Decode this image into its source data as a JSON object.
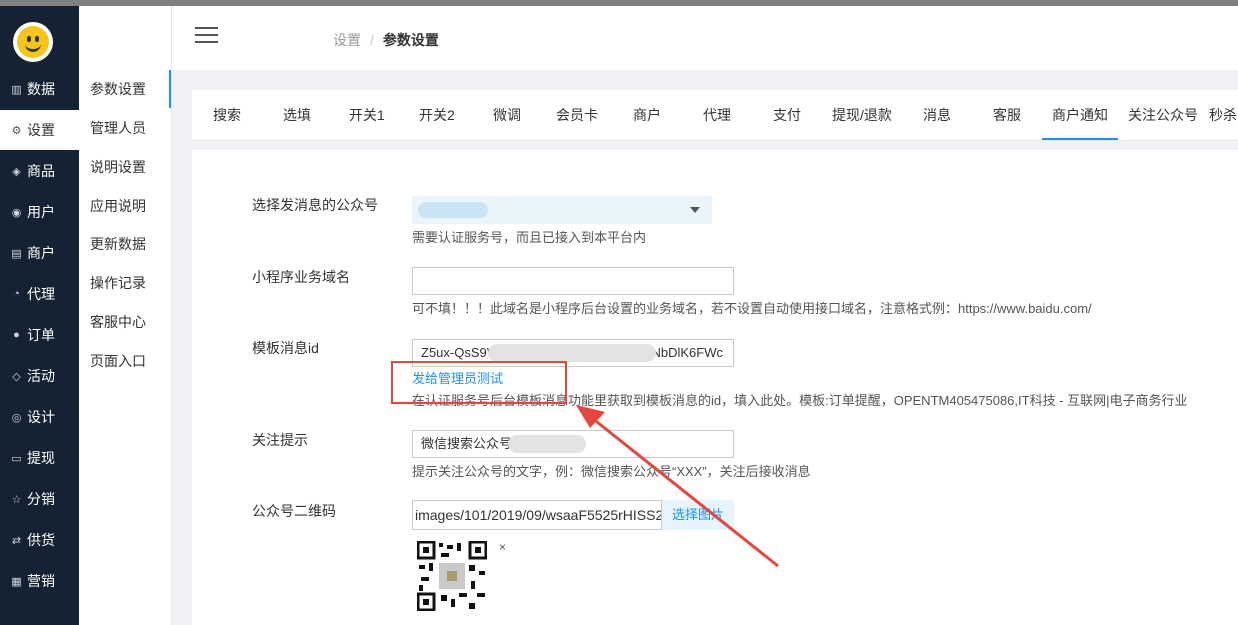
{
  "left_nav": {
    "logo_icon": "smiley-face-icon",
    "items": [
      {
        "label": "数据",
        "icon": "chart-icon"
      },
      {
        "label": "设置",
        "icon": "gear-icon"
      },
      {
        "label": "商品",
        "icon": "box-icon"
      },
      {
        "label": "用户",
        "icon": "user-icon"
      },
      {
        "label": "商户",
        "icon": "store-icon"
      },
      {
        "label": "代理",
        "icon": "agent-icon"
      },
      {
        "label": "订单",
        "icon": "order-icon"
      },
      {
        "label": "活动",
        "icon": "tag-icon"
      },
      {
        "label": "设计",
        "icon": "design-icon"
      },
      {
        "label": "提现",
        "icon": "withdraw-icon"
      },
      {
        "label": "分销",
        "icon": "distribution-icon"
      },
      {
        "label": "供货",
        "icon": "supply-icon"
      },
      {
        "label": "营销",
        "icon": "grid-icon"
      }
    ],
    "active_index": 1
  },
  "sub_nav": {
    "items": [
      "参数设置",
      "管理人员",
      "说明设置",
      "应用说明",
      "更新数据",
      "操作记录",
      "客服中心",
      "页面入口"
    ],
    "active_index": 0
  },
  "breadcrumb": {
    "crumb1": "设置",
    "separator": "/",
    "crumb2": "参数设置"
  },
  "tabs": {
    "items": [
      "搜索",
      "选填",
      "开关1",
      "开关2",
      "微调",
      "会员卡",
      "商户",
      "代理",
      "支付",
      "提现/退款",
      "消息",
      "客服",
      "商户通知",
      "关注公众号",
      "秒杀"
    ],
    "active_index": 12
  },
  "form": {
    "official_account": {
      "label": "选择发消息的公众号",
      "hint": "需要认证服务号，而且已接入到本平台内"
    },
    "miniprogram_domain": {
      "label": "小程序业务域名",
      "value": "",
      "hint": "可不填！！！此域名是小程序后台设置的业务域名，若不设置自动使用接口域名，注意格式例：https://www.baidu.com/"
    },
    "template_id": {
      "label": "模板消息id",
      "value_start": "Z5ux-QsS9V",
      "value_end": "NbDlK6FWc",
      "test_link": "发给管理员测试",
      "hint": "在认证服务号后台模板消息功能里获取到模板消息的id，填入此处。模板:订单提醒，OPENTM405475086,IT科技 - 互联网|电子商务行业"
    },
    "follow_tip": {
      "label": "关注提示",
      "value": "微信搜索公众号",
      "hint": "提示关注公众号的文字，例：微信搜索公众号“XXX”，关注后接收消息"
    },
    "qr_code": {
      "label": "公众号二维码",
      "value": "images/101/2019/09/wsaaF5525rHISS2",
      "choose_button": "选择图片",
      "remove": "×"
    }
  },
  "colors": {
    "sidebar": "#152233",
    "accent": "#1890ff",
    "annotation": "#e8453c"
  }
}
